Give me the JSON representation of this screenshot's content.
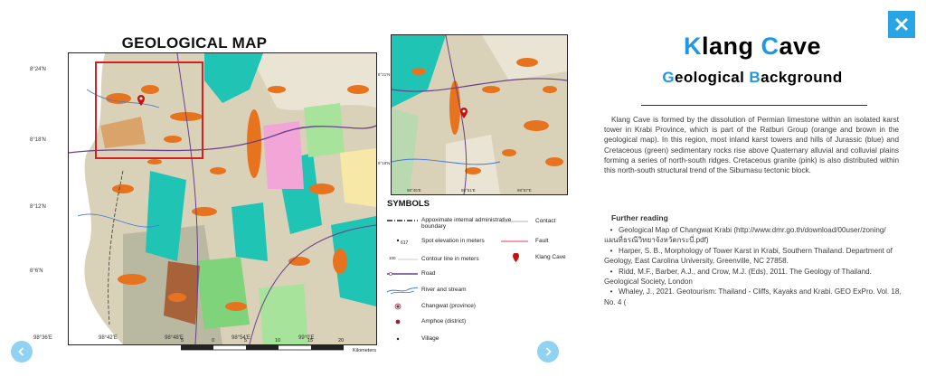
{
  "map": {
    "title": "GEOLOGICAL MAP",
    "lat_labels": [
      "8°24'N",
      "8°18'N",
      "8°12'N",
      "8°6'N"
    ],
    "lon_labels": [
      "98°36'E",
      "98°42'E",
      "98°48'E",
      "98°54'E",
      "99°0'E"
    ],
    "scale_ticks": [
      "5",
      "0",
      "5",
      "10",
      "15",
      "20"
    ],
    "scale_unit": "Kilometers"
  },
  "inset": {
    "lat_labels": [
      "8°21'N",
      "8°18'N"
    ],
    "lon_labels": [
      "98°45'E",
      "98°51'E",
      "98°57'E"
    ]
  },
  "symbols": {
    "title": "SYMBOLS",
    "items": {
      "boundary": "Appoximate internal administrative boundary",
      "contact": "Contact",
      "spot": "Spot elevation in meters",
      "fault": "Fault",
      "contour": "Contour line in meters",
      "cave": "Klang Cave",
      "road": "Road",
      "river": "River and stream",
      "changwat": "Changwat (province)",
      "amphoe": "Amphoe (district)",
      "village": "Village"
    }
  },
  "heading": {
    "title_first": "K",
    "title_mid": "lang ",
    "title_accent2": "C",
    "title_rest": "ave",
    "sub_first": "G",
    "sub_mid": "eological ",
    "sub_accent2": "B",
    "sub_rest": "ackground"
  },
  "description": "Klang Cave is formed by the dissolution of Permian limestone within an isolated karst tower in Krabi Province, which is part of the Ratburi Group (orange and brown in the geological map). In this region, most inland karst towers and hills of Jurassic (blue) and Cretaceous (green) sedimentary rocks rise above Quaternary alluvial and colluvial plains forming a series of north-south ridges. Cretaceous granite (pink) is also distributed within this north-south structural trend of the Sibumasu tectonic block.",
  "further_reading": {
    "title": "Further reading",
    "items": [
      "Geological Map of Changwat Krabi (http://www.dmr.go.th/download/00user/zoning/แผนที่ธรณีวิทยาจังหวัดกระบี่.pdf)",
      "Harper, S. B., Morphology of Tower Karst in Krabi, Southern Thailand. Department of Geology, East Carolina University, Greenville, NC 27858.",
      "Ridd, M.F., Barber, A.J., and Crow, M.J. (Eds), 2011. The Geology of Thailand. Geological Society, London",
      "Whaley, J., 2021. Geotourism: Thailand - Cliffs, Kayaks and Krabi. GEO ExPro. Vol. 18, No. 4 ("
    ]
  },
  "colors": {
    "accent": "#1e98e6",
    "close_bg": "#29a5e5",
    "nav_bg": "#8fd2f2",
    "permian_orange": "#e8731e",
    "jurassic_teal": "#1fc4b4",
    "granite_pink": "#f2a6d8",
    "plain_beige": "#d9d2b8"
  },
  "icons": {
    "close": "close-icon",
    "prev": "chevron-left-icon",
    "next": "chevron-right-icon",
    "cave_marker": "map-pin-icon"
  }
}
